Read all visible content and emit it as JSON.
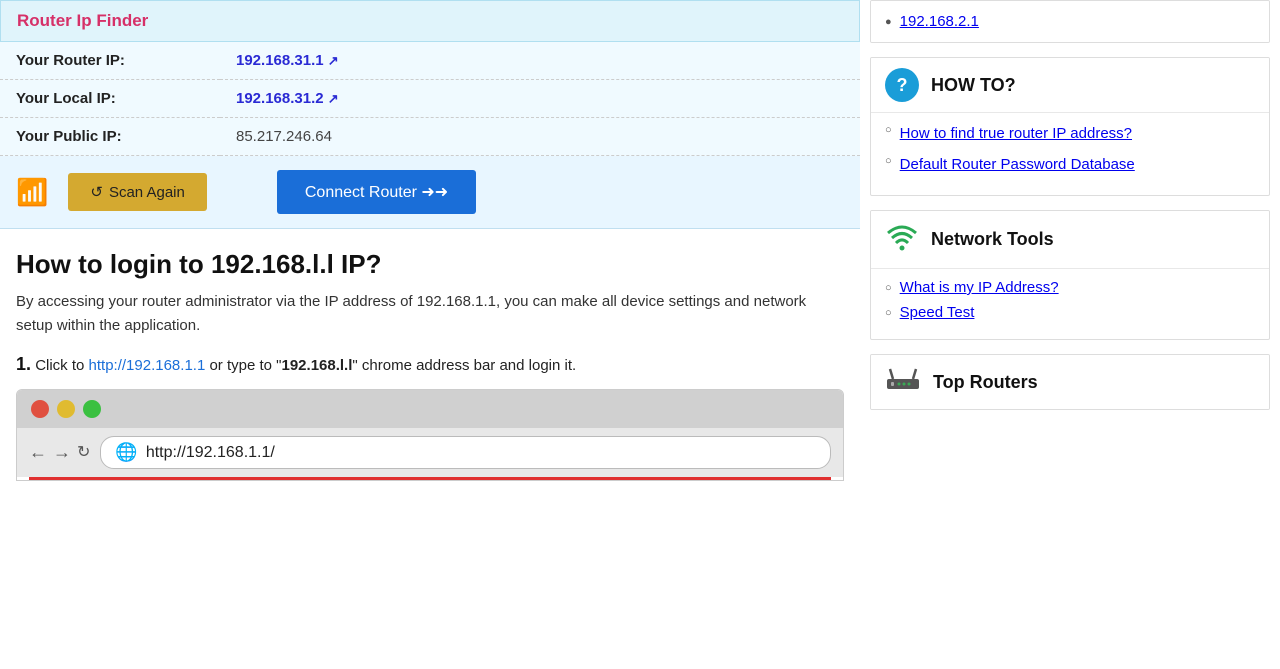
{
  "header": {
    "title": "Router Ip Finder"
  },
  "ip_info": {
    "router_ip_label": "Your Router IP:",
    "router_ip_value": "192.168.31.1",
    "local_ip_label": "Your Local IP:",
    "local_ip_value": "192.168.31.2",
    "public_ip_label": "Your Public IP:",
    "public_ip_value": "85.217.246.64"
  },
  "actions": {
    "scan_label": "Scan Again",
    "connect_label": "Connect Router ➜➜"
  },
  "article": {
    "heading": "How to login to 192.168.l.l IP?",
    "description": "By accessing your router administrator via the IP address of 192.168.1.1, you can make all device settings and network setup within the application.",
    "step1_prefix": "Click to ",
    "step1_link": "http://192.168.1.1",
    "step1_suffix": " or type to \"",
    "step1_bold": "192.168.l.l",
    "step1_end": "\" chrome address bar and login it.",
    "browser_url": "http://192.168.1.1/"
  },
  "sidebar": {
    "prev_ip": "192.168.2.1",
    "howto": {
      "icon_char": "?",
      "title": "HOW TO?",
      "links": [
        "How to find true router IP address?",
        "Default Router Password Database"
      ]
    },
    "nettools": {
      "title": "Network Tools",
      "links": [
        "What is my IP Address?",
        "Speed Test"
      ]
    },
    "toprouters": {
      "title": "Top Routers"
    }
  }
}
